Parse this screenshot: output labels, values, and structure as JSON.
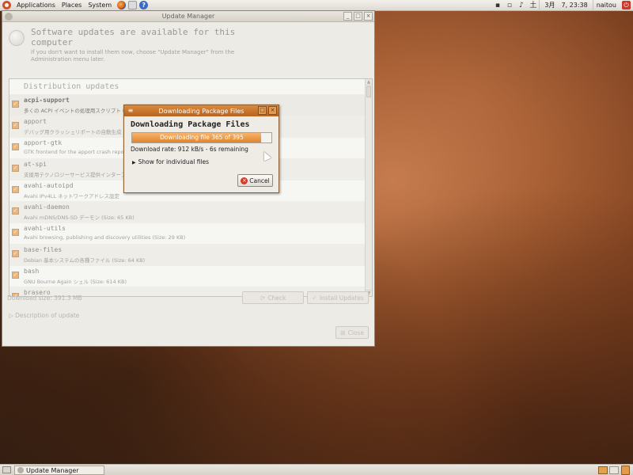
{
  "top_panel": {
    "menus": [
      "Applications",
      "Places",
      "System"
    ],
    "clock": "3月　7, 23:38",
    "user": "naitou"
  },
  "update_manager": {
    "title": "Update Manager",
    "headline": "Software updates are available for this computer",
    "subtext": "If you don't want to install them now, choose \"Update Manager\" from the Administration menu later.",
    "section": "Distribution updates",
    "packages": [
      {
        "name": "acpi-support",
        "desc": "多くの ACPI イベントの処理用スクリプト (Size: 37 KB)"
      },
      {
        "name": "apport",
        "desc": "デバッグ用クラッシュリポートの自動生成"
      },
      {
        "name": "apport-gtk",
        "desc": "GTK frontend for the apport crash report"
      },
      {
        "name": "at-spi",
        "desc": "支援用テクノロジーサービス提供インターフェ"
      },
      {
        "name": "avahi-autoipd",
        "desc": "Avahi IPv4LL ネットワークアドレス設定"
      },
      {
        "name": "avahi-daemon",
        "desc": "Avahi mDNS/DNS-SD デーモン (Size: 65 KB)"
      },
      {
        "name": "avahi-utils",
        "desc": "Avahi browsing, publishing and discovery utilities (Size: 29 KB)"
      },
      {
        "name": "base-files",
        "desc": "Debian 基本システムの各種ファイル (Size: 64 KB)"
      },
      {
        "name": "bash",
        "desc": "GNU Bourne Again シェル (Size: 614 KB)"
      },
      {
        "name": "brasero",
        "desc": ""
      }
    ],
    "download_size": "Download size: 391.3 MB",
    "check_label": "Check",
    "install_label": "Install Updates",
    "description_label": "Description of update",
    "close_label": "Close"
  },
  "download_dialog": {
    "title": "Downloading Package Files",
    "heading": "Downloading Package Files",
    "progress_text": "Downloading file 365 of 395",
    "progress_fraction": 0.924,
    "rate": "Download rate: 912 kB/s - 6s remaining",
    "show_files": "Show for individual files",
    "cancel_label": "Cancel"
  },
  "bottom_panel": {
    "task": "Update Manager"
  },
  "colors": {
    "accent": "#e0842f",
    "titlebar_active": "#c46e27"
  }
}
